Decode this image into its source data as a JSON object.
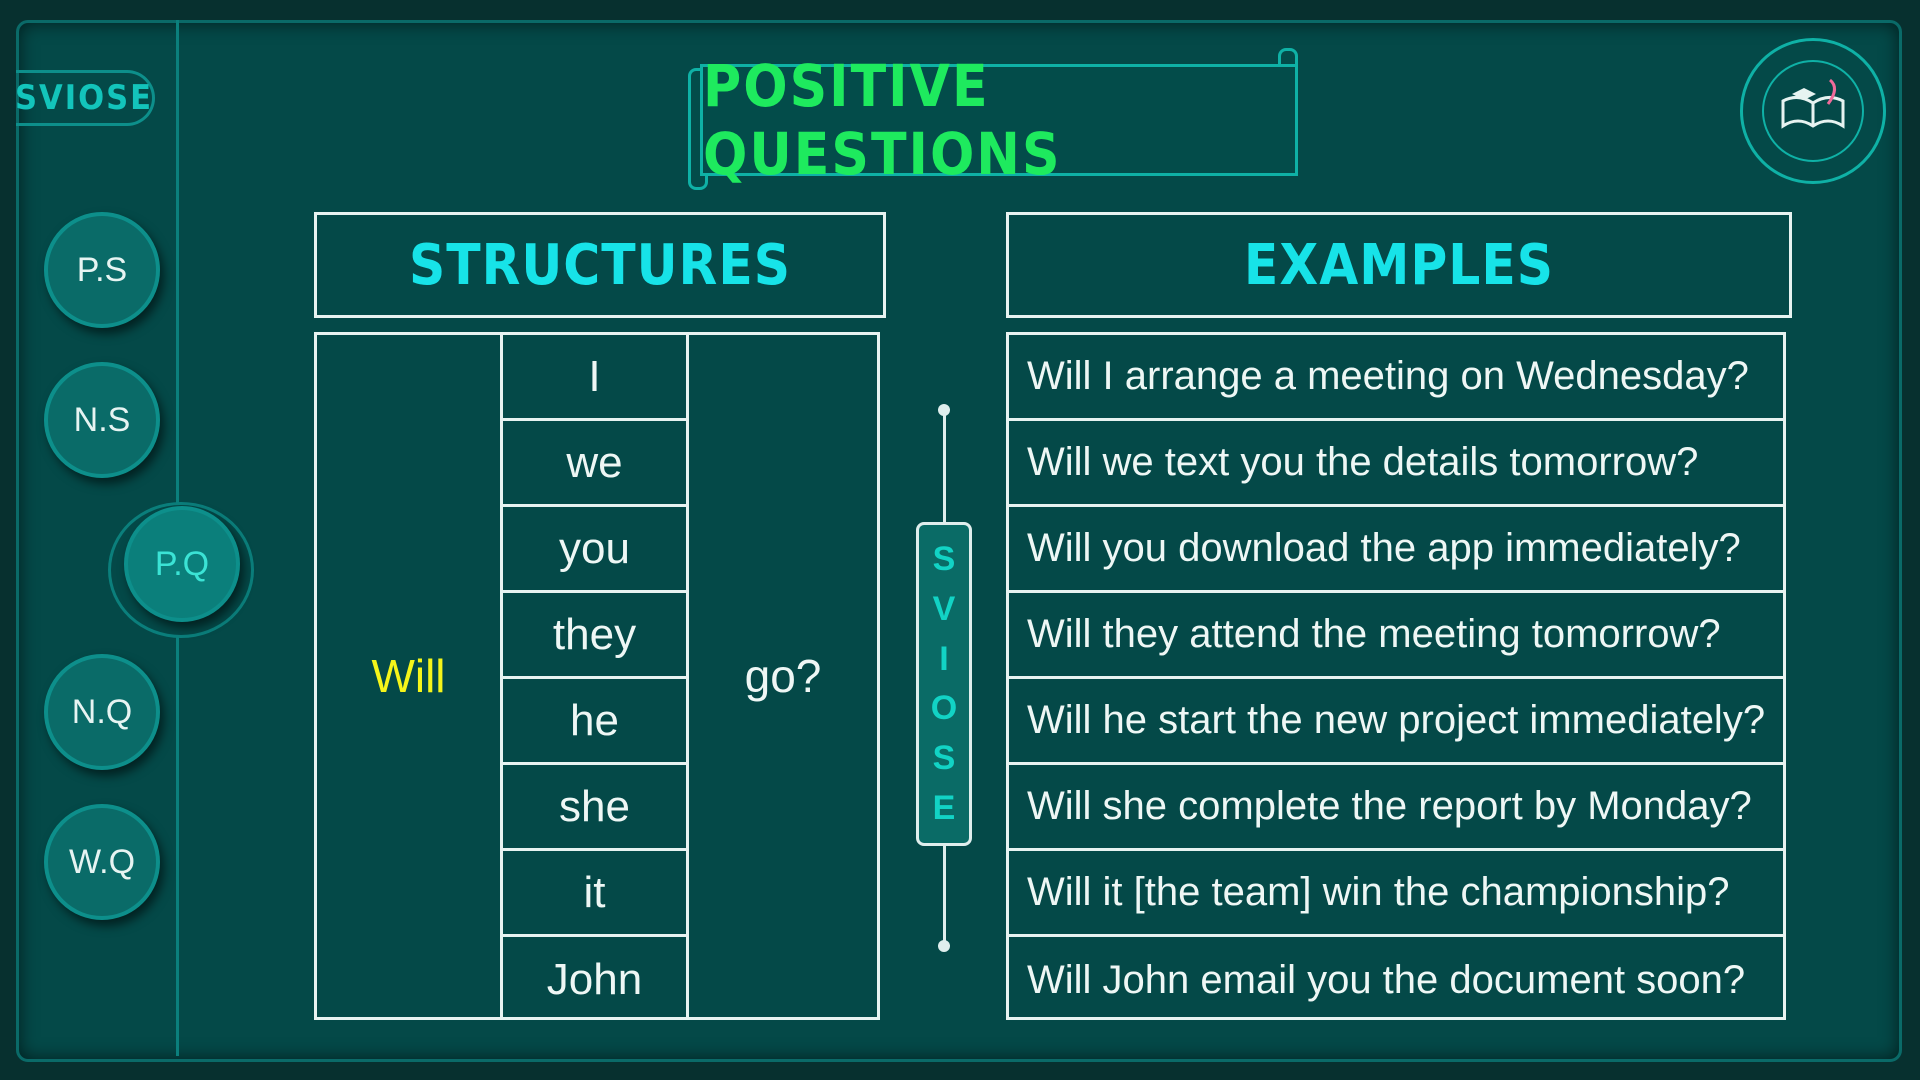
{
  "brand": "SVIOSE",
  "nav": [
    {
      "label": "P.S",
      "active": false
    },
    {
      "label": "N.S",
      "active": false
    },
    {
      "label": "P.Q",
      "active": true
    },
    {
      "label": "N.Q",
      "active": false
    },
    {
      "label": "W.Q",
      "active": false
    }
  ],
  "title": "POSITIVE QUESTIONS",
  "structures": {
    "header": "STRUCTURES",
    "aux": "Will",
    "subjects": [
      "I",
      "we",
      "you",
      "they",
      "he",
      "she",
      "it",
      "John"
    ],
    "verb": "go?"
  },
  "examples": {
    "header": "EXAMPLES",
    "rows": [
      "Will I arrange a meeting on Wednesday?",
      "Will we text you the details tomorrow?",
      "Will you download the app immediately?",
      "Will they attend the meeting tomorrow?",
      "Will he start the new project immediately?",
      "Will she complete the report by Monday?",
      "Will it [the team] win the championship?",
      "Will John email you the document soon?"
    ]
  },
  "vertical_badge": [
    "S",
    "V",
    "I",
    "O",
    "S",
    "E"
  ],
  "colors": {
    "background": "#044948",
    "title": "#1eea5e",
    "header": "#17e3e8",
    "aux": "#f5f51a"
  }
}
